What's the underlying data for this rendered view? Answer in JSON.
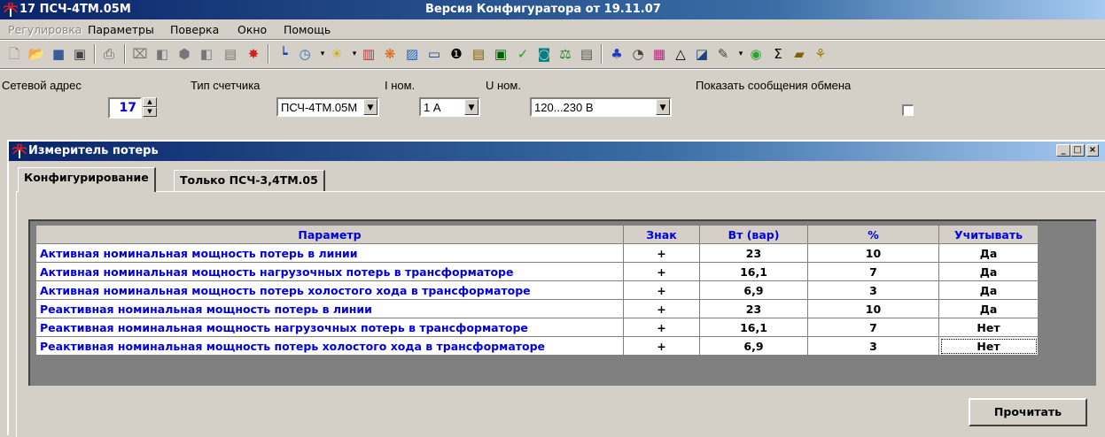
{
  "app": {
    "title": "17 ПСЧ-4ТМ.05М",
    "version": "Версия Конфигуратора  от 19.11.07"
  },
  "menu": {
    "items": [
      {
        "label": "Регулировка",
        "disabled": true
      },
      {
        "label": "Параметры",
        "disabled": false
      },
      {
        "label": "Поверка",
        "disabled": false
      },
      {
        "label": "Окно",
        "disabled": false
      },
      {
        "label": "Помощь",
        "disabled": false
      }
    ]
  },
  "toolbar": {
    "icons": [
      "new-file-icon",
      "open-folder-icon",
      "save-icon",
      "save-all-icon",
      "print-icon",
      "clear-icon",
      "cut-icon",
      "network-icon",
      "copy-icon",
      "calculator-icon",
      "bug-icon",
      "chart-axes-icon",
      "clock-icon",
      "sun-icon",
      "bar-chart-icon",
      "palette-icon",
      "picture-icon",
      "window-icon",
      "info-icon",
      "document-icon",
      "monitor-icon",
      "checkmark-icon",
      "screen-icon",
      "scales-icon",
      "computer-icon",
      "tree-icon",
      "stopwatch-icon",
      "graph-icon",
      "triangle-icon",
      "image-icon",
      "wand-icon",
      "globe-icon",
      "sigma-icon",
      "box-icon",
      "exit-icon"
    ]
  },
  "addr_bar": {
    "net_addr_label": "Сетевой адрес",
    "net_addr_value": "17",
    "meter_type_label": "Тип счетчика",
    "meter_type_value": "ПСЧ-4ТМ.05М",
    "i_nom_label": "I ном.",
    "i_nom_value": "1 А",
    "u_nom_label": "U ном.",
    "u_nom_value": "120...230 В",
    "show_msgs_label": "Показать сообщения обмена",
    "show_msgs_checked": false
  },
  "child_window": {
    "title": "Измеритель потерь",
    "tabs": [
      {
        "label": "Конфигурирование",
        "active": true
      },
      {
        "label": "Только ПСЧ-3,4ТМ.05",
        "active": false
      }
    ]
  },
  "grid": {
    "columns": [
      "Параметр",
      "Знак",
      "Вт (вар)",
      "%",
      "Учитывать"
    ],
    "rows": [
      {
        "param": "Активная номинальная мощность потерь в линии",
        "sign": "+",
        "value": "23",
        "percent": "10",
        "use": "Да"
      },
      {
        "param": "Активная номинальная мощность нагрузочных потерь в трансформаторе",
        "sign": "+",
        "value": "16,1",
        "percent": "7",
        "use": "Да"
      },
      {
        "param": "Активная номинальная мощность потерь холостого хода в трансформаторе",
        "sign": "+",
        "value": "6,9",
        "percent": "3",
        "use": "Да"
      },
      {
        "param": "Реактивная номинальная мощность потерь в линии",
        "sign": "+",
        "value": "23",
        "percent": "10",
        "use": "Да"
      },
      {
        "param": "Реактивная номинальная мощность нагрузочных потерь в трансформаторе",
        "sign": "+",
        "value": "16,1",
        "percent": "7",
        "use": "Нет"
      },
      {
        "param": "Реактивная номинальная мощность потерь холостого хода в трансформаторе",
        "sign": "+",
        "value": "6,9",
        "percent": "3",
        "use": "Нет"
      }
    ]
  },
  "buttons": {
    "read_label": "Прочитать"
  },
  "colors": {
    "title_bar": "#0a246a",
    "param_text": "#0000e0",
    "face": "#d4d0c8"
  }
}
